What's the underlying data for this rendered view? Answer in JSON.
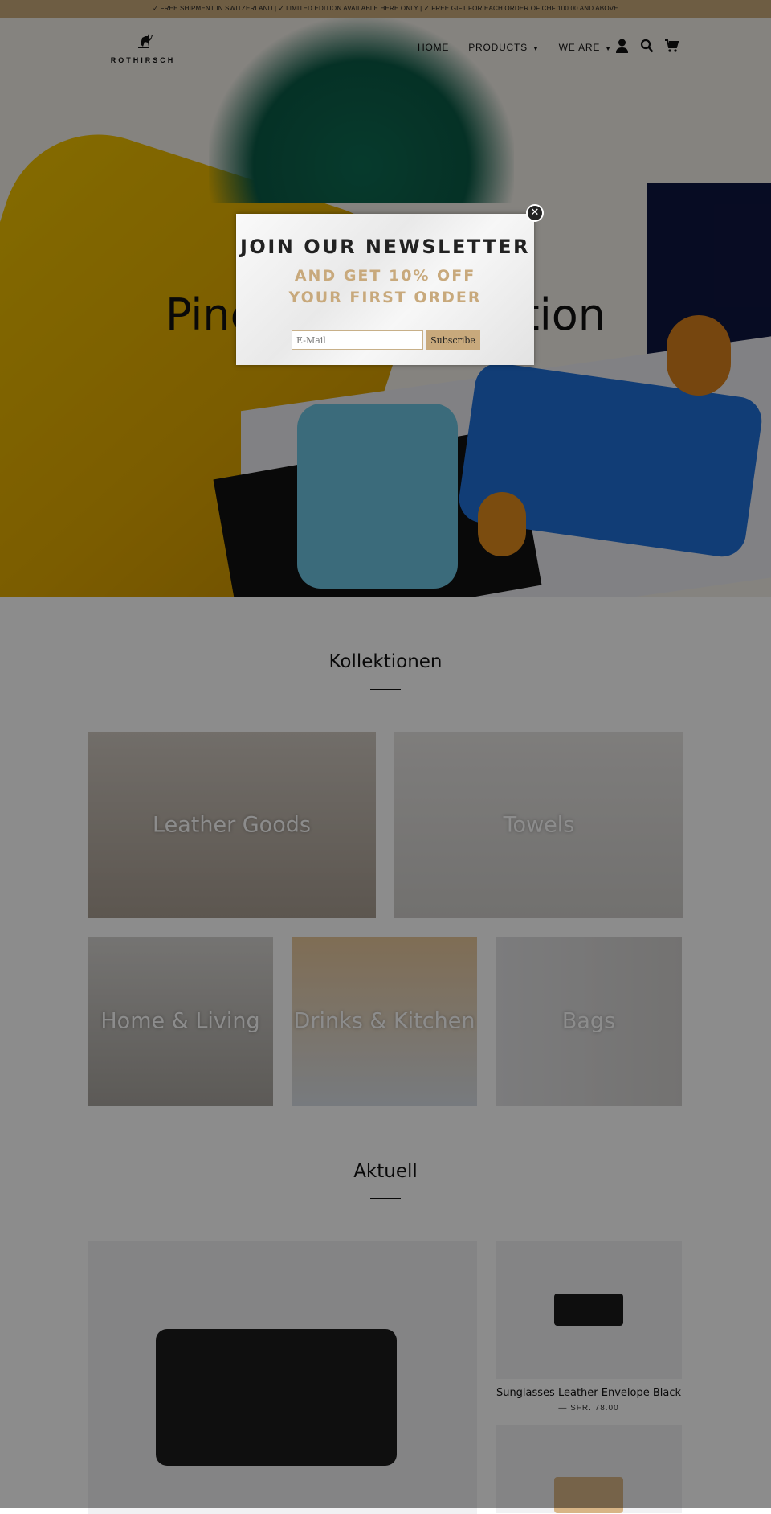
{
  "announcement": "✓ FREE SHIPMENT IN SWITZERLAND | ✓ LIMITED EDITION AVAILABLE HERE ONLY | ✓ FREE GIFT FOR EACH ORDER OF CHF 100.00 AND ABOVE",
  "header": {
    "logo": "ROTHIRSCH",
    "nav": [
      {
        "label": "HOME"
      },
      {
        "label": "PRODUCTS"
      },
      {
        "label": "WE ARE"
      }
    ],
    "icons": [
      "account-icon",
      "search-icon",
      "cart-icon"
    ]
  },
  "hero": {
    "title": "Pineapple Collection"
  },
  "collections": {
    "title": "Kollektionen",
    "items": [
      {
        "label": "Leather Goods"
      },
      {
        "label": "Towels"
      },
      {
        "label": "Home & Living"
      },
      {
        "label": "Drinks & Kitchen"
      },
      {
        "label": "Bags"
      }
    ]
  },
  "current": {
    "title": "Aktuell",
    "products": [
      {
        "title": "Sunglasses Leather Envelope Black",
        "price": "— SFR. 78.00"
      }
    ]
  },
  "popup": {
    "title": "JOIN OUR NEWSLETTER",
    "subtitle_1": "AND GET 10% OFF",
    "subtitle_2": "YOUR FIRST ORDER",
    "email_placeholder": "E-Mail",
    "subscribe": "Subscribe",
    "accent": "#c8a97c"
  }
}
